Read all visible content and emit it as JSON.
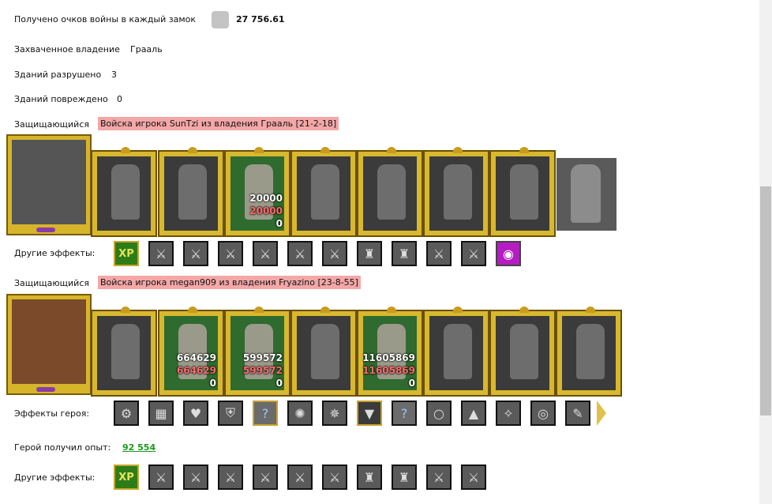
{
  "war_points": {
    "label": "Получено очков войны в каждый замок",
    "value": "27 756.61"
  },
  "captured": {
    "label": "Захваченное владение",
    "value": "Грааль"
  },
  "buildings_destroyed": {
    "label": "Зданий разрушено",
    "value": "3"
  },
  "buildings_damaged": {
    "label": "Зданий повреждено",
    "value": "0"
  },
  "defender1": {
    "label": "Защищающийся",
    "title": "Войска игрока SunTzi из владения Грааль [21-2-18]",
    "hero_icon": "crossed-bows-crest-icon",
    "unit_with_stats": {
      "count": "20000",
      "lost": "20000",
      "left": "0"
    },
    "effects_label": "Другие эффекты:",
    "effects_xp": "XP"
  },
  "defender2": {
    "label": "Защищающийся",
    "title": "Войска игрока megan909 из владения Fryazino [23-8-55]",
    "hero_icon": "skull-warrior-portrait-icon",
    "unit_a": {
      "count": "664629",
      "lost": "664629",
      "left": "0"
    },
    "unit_b": {
      "count": "599572",
      "lost": "599572",
      "left": "0"
    },
    "unit_c": {
      "count": "11605869",
      "lost": "11605869",
      "left": "0"
    },
    "hero_effects_label": "Эффекты героя:",
    "q_mark": "?",
    "exp_label": "Герой получил опыт:",
    "exp_value": "92 554",
    "effects_label": "Другие эффекты:",
    "effects_xp": "XP"
  }
}
